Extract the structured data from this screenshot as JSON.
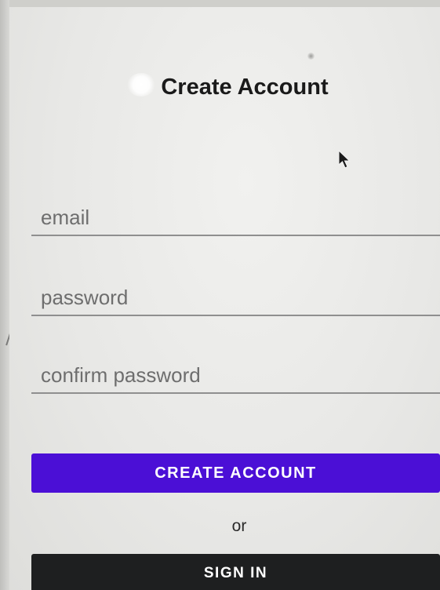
{
  "screen": {
    "title": "Create Account"
  },
  "form": {
    "email_placeholder": "email",
    "password_placeholder": "password",
    "confirm_password_placeholder": "confirm password"
  },
  "actions": {
    "create_account_label": "CREATE ACCOUNT",
    "separator_text": "or",
    "sign_in_label": "SIGN IN"
  },
  "colors": {
    "primary_button": "#4b0fd6",
    "secondary_button": "#1e1f20",
    "background": "#e9e9e7"
  },
  "icons": {
    "cursor": "mouse-pointer-icon"
  }
}
